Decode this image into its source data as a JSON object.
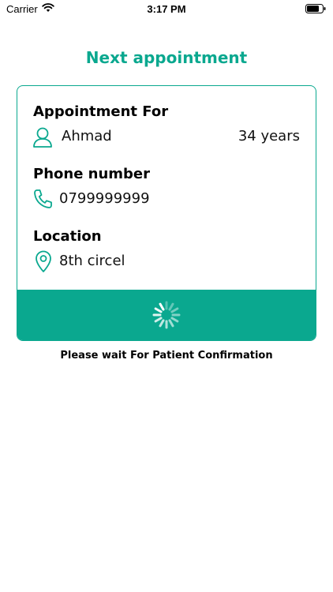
{
  "colors": {
    "accent": "#0aa88f"
  },
  "status_bar": {
    "carrier": "Carrier",
    "time": "3:17 PM",
    "wifi_icon": "wifi-icon",
    "battery_icon": "battery-icon"
  },
  "title": "Next appointment",
  "card": {
    "appointment_for": {
      "label": "Appointment For",
      "icon": "user-icon",
      "name": "Ahmad",
      "age": "34 years"
    },
    "phone": {
      "label": "Phone number",
      "icon": "phone-icon",
      "value": "0799999999"
    },
    "location": {
      "label": "Location",
      "icon": "location-pin-icon",
      "value": "8th circel"
    },
    "footer_icon": "loading-spinner-icon"
  },
  "wait_message": "Please wait For Patient Confirmation"
}
